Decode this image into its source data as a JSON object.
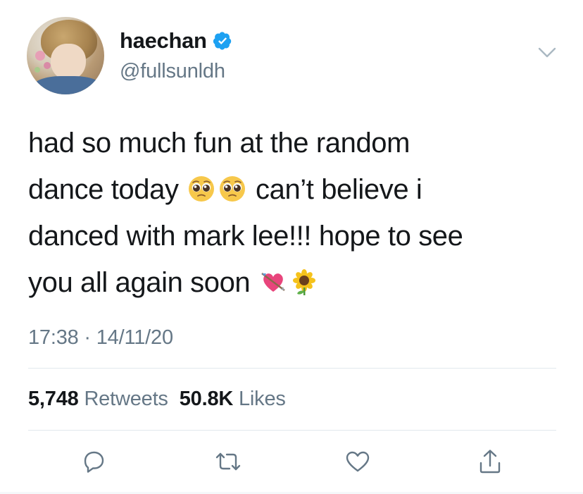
{
  "user": {
    "display_name": "haechan",
    "handle": "@fullsunldh",
    "verified": true
  },
  "tweet": {
    "line1": "had so much fun at the random",
    "line2_pre": "dance today",
    "line2_post": "can’t believe i",
    "line3": "danced with mark lee!!! hope to see",
    "line4": "you all again soon",
    "emojis": [
      "pleading-face",
      "pleading-face",
      "heart-with-arrow",
      "sunflower"
    ]
  },
  "meta": {
    "time": "17:38 · 14/11/20"
  },
  "stats": {
    "retweets_count": "5,748",
    "retweets_label": "Retweets",
    "likes_count": "50.8K",
    "likes_label": "Likes"
  },
  "colors": {
    "text": "#14171a",
    "secondary": "#657786",
    "verified_blue": "#1da1f2",
    "divider": "#e1e8ed"
  },
  "actions": [
    "reply-icon",
    "retweet-icon",
    "like-icon",
    "share-icon"
  ]
}
